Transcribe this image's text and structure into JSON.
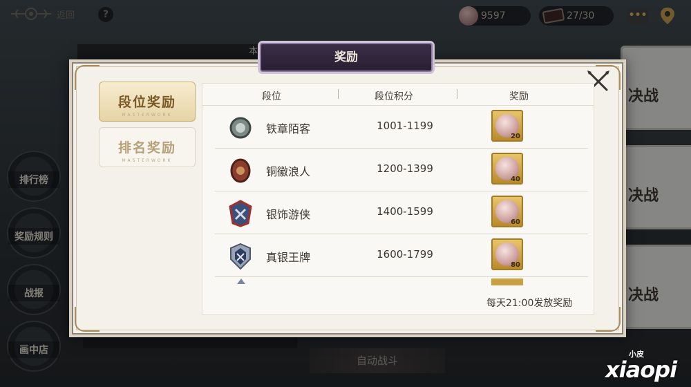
{
  "top": {
    "back_label": "返回",
    "help_label": "?",
    "coins": "9597",
    "tickets": "27/30",
    "chat_label": "•••"
  },
  "left_buttons": [
    "排行榜",
    "奖励规则",
    "战报",
    "画中店"
  ],
  "right_cards": [
    "决战",
    "决战",
    "决战"
  ],
  "behind": {
    "top_strip": "本期",
    "auto_battle": "自动战斗"
  },
  "modal": {
    "title": "奖励",
    "tabs": [
      {
        "label": "段位奖励",
        "sub": "MASTERWORK",
        "active": true
      },
      {
        "label": "排名奖励",
        "sub": "MASTERWORK",
        "active": false
      }
    ],
    "columns": [
      "段位",
      "段位积分",
      "奖励"
    ],
    "rows": [
      {
        "name": "铁章陌客",
        "range": "1001-1199",
        "reward_qty": "20"
      },
      {
        "name": "铜徽浪人",
        "range": "1200-1399",
        "reward_qty": "40"
      },
      {
        "name": "银饰游侠",
        "range": "1400-1599",
        "reward_qty": "60"
      },
      {
        "name": "真银王牌",
        "range": "1600-1799",
        "reward_qty": "80"
      }
    ],
    "footer_note": "每天21:00发放奖励"
  },
  "watermark": {
    "small": "小皮",
    "big": "xiaopi"
  },
  "colors": {
    "accent_gold": "#c7ae72",
    "title_purple": "#3a2d46"
  }
}
